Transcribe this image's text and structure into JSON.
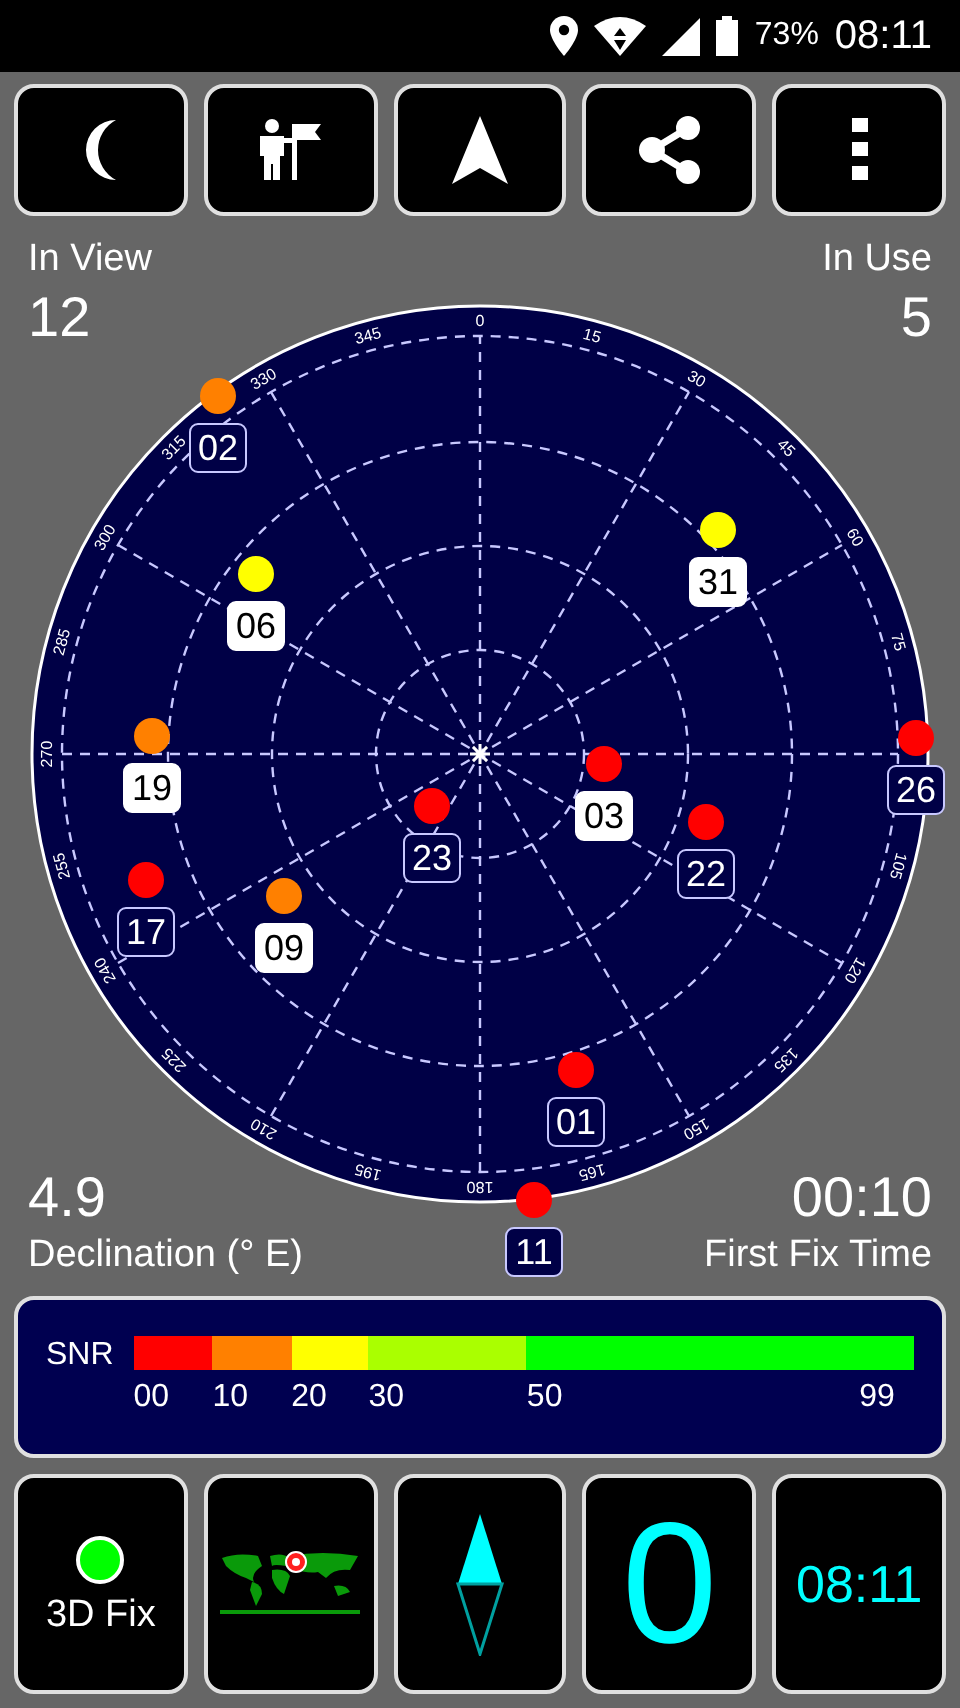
{
  "status_bar": {
    "battery": "73%",
    "time": "08:11"
  },
  "toolbar": [
    {
      "kind": "night"
    },
    {
      "kind": "guide"
    },
    {
      "kind": "navigate"
    },
    {
      "kind": "share"
    },
    {
      "kind": "more"
    }
  ],
  "in_view": {
    "label": "In View",
    "value": "12"
  },
  "in_use": {
    "label": "In Use",
    "value": "5"
  },
  "sky": {
    "azimuth_labels": [
      "0",
      "15",
      "30",
      "45",
      "60",
      "75",
      "105",
      "120",
      "135",
      "150",
      "165",
      "180",
      "195",
      "210",
      "225",
      "240",
      "255",
      "270",
      "285",
      "300",
      "315",
      "330",
      "345"
    ],
    "satellites": [
      {
        "id": "02",
        "color": "#ff8000",
        "used": false
      },
      {
        "id": "06",
        "color": "#ffff00",
        "used": true
      },
      {
        "id": "31",
        "color": "#ffff00",
        "used": true
      },
      {
        "id": "19",
        "color": "#ff8000",
        "used": true
      },
      {
        "id": "26",
        "color": "#ff0000",
        "used": false
      },
      {
        "id": "03",
        "color": "#ff0000",
        "used": true
      },
      {
        "id": "23",
        "color": "#ff0000",
        "used": false
      },
      {
        "id": "22",
        "color": "#ff0000",
        "used": false
      },
      {
        "id": "17",
        "color": "#ff0000",
        "used": false
      },
      {
        "id": "09",
        "color": "#ff8000",
        "used": true
      },
      {
        "id": "01",
        "color": "#ff0000",
        "used": false
      },
      {
        "id": "11",
        "color": "#ff0000",
        "used": false
      }
    ]
  },
  "declination": {
    "value": "4.9",
    "label": "Declination (° E)"
  },
  "first_fix": {
    "value": "00:10",
    "label": "First Fix Time"
  },
  "snr": {
    "label": "SNR",
    "segments": [
      {
        "color": "#ff0000",
        "tick": "00"
      },
      {
        "color": "#ff8000",
        "tick": "10"
      },
      {
        "color": "#ffff00",
        "tick": "20"
      },
      {
        "color": "#aaff00",
        "tick": "30"
      },
      {
        "color": "#00ff00",
        "tick": "50"
      }
    ],
    "end_tick": "99"
  },
  "tiles": [
    {
      "kind": "fix",
      "label": "3D Fix",
      "color": "#00ff00"
    },
    {
      "kind": "map"
    },
    {
      "kind": "compass"
    },
    {
      "kind": "speed",
      "value": "0"
    },
    {
      "kind": "clock",
      "value": "08:11"
    }
  ]
}
